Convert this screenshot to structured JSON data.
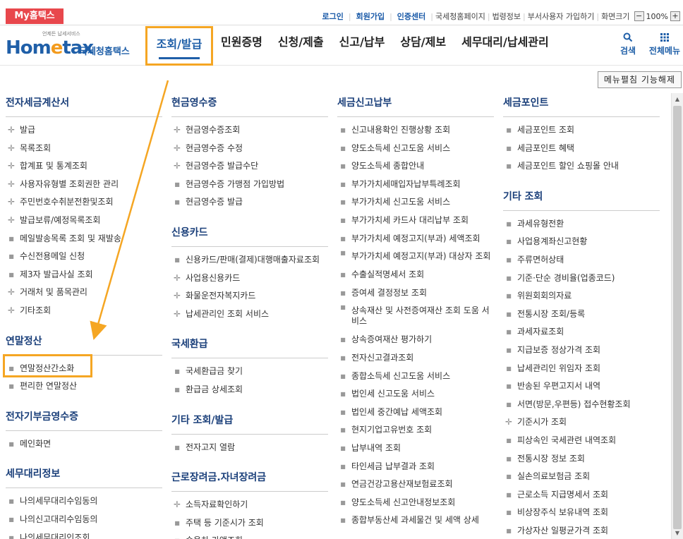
{
  "topbar": {
    "my_badge": "My홈택스",
    "links": [
      "로그인",
      "회원가입",
      "인증센터"
    ],
    "gray_links": [
      "국세청홈페이지",
      "법령정보",
      "부서사용자 가입하기",
      "화면크기"
    ],
    "zoom": {
      "minus": "−",
      "value": "100%",
      "plus": "+"
    }
  },
  "header": {
    "logo_small": "언제든 납세서비스",
    "logo_main_a": "Hom",
    "logo_main_e": "e",
    "logo_main_b": "tax",
    "logo_kr": "국세청홈택스",
    "nav": [
      "조회/발급",
      "민원증명",
      "신청/제출",
      "신고/납부",
      "상담/제보",
      "세무대리/납세관리"
    ],
    "search_label": "검색",
    "allmenu_label": "전체메뉴",
    "search_icon": "search-icon",
    "grid_icon": "grid-icon"
  },
  "collapse_button": "메뉴펼침 기능해제",
  "columns": [
    {
      "sections": [
        {
          "title": "전자세금계산서",
          "items": [
            {
              "label": "발급",
              "mark": "plus"
            },
            {
              "label": "목록조회",
              "mark": "plus"
            },
            {
              "label": "합계표 및 통계조회",
              "mark": "plus"
            },
            {
              "label": "사용자유형별 조회권한 관리",
              "mark": "plus"
            },
            {
              "label": "주민번호수취분전환및조회",
              "mark": "plus"
            },
            {
              "label": "발급보류/예정목록조회",
              "mark": "plus"
            },
            {
              "label": "메일발송목록 조회 및 재발송",
              "mark": "dot"
            },
            {
              "label": "수신전용메일 신청",
              "mark": "dot"
            },
            {
              "label": "제3자 발급사실 조회",
              "mark": "dot"
            },
            {
              "label": "거래처 및 품목관리",
              "mark": "plus"
            },
            {
              "label": "기타조회",
              "mark": "plus"
            }
          ]
        },
        {
          "title": "연말정산",
          "items": [
            {
              "label": "연말정산간소화",
              "mark": "dot"
            },
            {
              "label": "편리한 연말정산",
              "mark": "dot"
            }
          ]
        },
        {
          "title": "전자기부금영수증",
          "items": [
            {
              "label": "메인화면",
              "mark": "dot"
            }
          ]
        },
        {
          "title": "세무대리정보",
          "items": [
            {
              "label": "나의세무대리수임동의",
              "mark": "dot"
            },
            {
              "label": "나의신고대리수임동의",
              "mark": "dot"
            },
            {
              "label": "나의세무대리인조회",
              "mark": "dot"
            }
          ]
        }
      ]
    },
    {
      "sections": [
        {
          "title": "현금영수증",
          "items": [
            {
              "label": "현금영수증조회",
              "mark": "plus"
            },
            {
              "label": "현금영수증 수정",
              "mark": "plus"
            },
            {
              "label": "현금영수증 발급수단",
              "mark": "plus"
            },
            {
              "label": "현금영수증 가맹점 가입방법",
              "mark": "dot"
            },
            {
              "label": "현금영수증 발급",
              "mark": "dot"
            }
          ]
        },
        {
          "title": "신용카드",
          "items": [
            {
              "label": "신용카드/판매(결제)대행매출자료조회",
              "mark": "dot"
            },
            {
              "label": "사업용신용카드",
              "mark": "plus"
            },
            {
              "label": "화물운전자복지카드",
              "mark": "plus"
            },
            {
              "label": "납세관리인 조회 서비스",
              "mark": "plus"
            }
          ]
        },
        {
          "title": "국세환급",
          "items": [
            {
              "label": "국세환급금 찾기",
              "mark": "dot"
            },
            {
              "label": "환급금 상세조회",
              "mark": "dot"
            }
          ]
        },
        {
          "title": "기타 조회/발급",
          "items": [
            {
              "label": "전자고지 열람",
              "mark": "dot"
            }
          ]
        },
        {
          "title": "근로장려금.자녀장려금",
          "items": [
            {
              "label": "소득자료확인하기",
              "mark": "plus"
            },
            {
              "label": "주택 등 기준시가 조회",
              "mark": "dot"
            },
            {
              "label": "승용차 가액조회",
              "mark": "dot"
            }
          ]
        }
      ]
    },
    {
      "sections": [
        {
          "title": "세금신고납부",
          "items": [
            {
              "label": "신고내용확인 진행상황 조회",
              "mark": "dot"
            },
            {
              "label": "양도소득세 신고도움 서비스",
              "mark": "dot"
            },
            {
              "label": "양도소득세 종합안내",
              "mark": "dot"
            },
            {
              "label": "부가가치세매입자납부특례조회",
              "mark": "dot"
            },
            {
              "label": "부가가치세 신고도움 서비스",
              "mark": "dot"
            },
            {
              "label": "부가가치세 카드사 대리납부 조회",
              "mark": "dot"
            },
            {
              "label": "부가가치세 예정고지(부과) 세액조회",
              "mark": "dot"
            },
            {
              "label": "부가가치세 예정고지(부과) 대상자 조회",
              "mark": "dot",
              "wrap": true
            },
            {
              "label": "수출실적명세서 조회",
              "mark": "dot"
            },
            {
              "label": "증여세 결정정보 조회",
              "mark": "dot"
            },
            {
              "label": "상속재산 및 사전증여재산 조회 도움 서비스",
              "mark": "dot",
              "wrap": true
            },
            {
              "label": "상속증여재산 평가하기",
              "mark": "dot"
            },
            {
              "label": "전자신고결과조회",
              "mark": "dot"
            },
            {
              "label": "종합소득세 신고도움 서비스",
              "mark": "dot"
            },
            {
              "label": "법인세 신고도움 서비스",
              "mark": "dot"
            },
            {
              "label": "법인세 중간예납 세액조회",
              "mark": "dot"
            },
            {
              "label": "현지기업고유번호 조회",
              "mark": "dot"
            },
            {
              "label": "납부내역 조회",
              "mark": "dot"
            },
            {
              "label": "타인세금 납부결과 조회",
              "mark": "dot"
            },
            {
              "label": "연금건강고용산재보험료조회",
              "mark": "dot"
            },
            {
              "label": "양도소득세 신고안내정보조회",
              "mark": "dot"
            },
            {
              "label": "종합부동산세 과세물건 및 세액 상세",
              "mark": "dot"
            }
          ]
        }
      ]
    },
    {
      "sections": [
        {
          "title": "세금포인트",
          "items": [
            {
              "label": "세금포인트 조회",
              "mark": "dot"
            },
            {
              "label": "세금포인트 혜택",
              "mark": "dot"
            },
            {
              "label": "세금포인트 할인 쇼핑몰 안내",
              "mark": "dot"
            }
          ]
        },
        {
          "title": "기타 조회",
          "items": [
            {
              "label": "과세유형전환",
              "mark": "dot"
            },
            {
              "label": "사업용계좌신고현황",
              "mark": "dot"
            },
            {
              "label": "주류면허상태",
              "mark": "dot"
            },
            {
              "label": "기준·단순 경비율(업종코드)",
              "mark": "dot"
            },
            {
              "label": "위원회회의자료",
              "mark": "dot"
            },
            {
              "label": "전통시장 조회/등록",
              "mark": "dot"
            },
            {
              "label": "과세자료조회",
              "mark": "dot"
            },
            {
              "label": "지급보증 정상가격 조회",
              "mark": "dot"
            },
            {
              "label": "납세관리인 위임자 조회",
              "mark": "dot"
            },
            {
              "label": "반송된 우편고지서 내역",
              "mark": "dot"
            },
            {
              "label": "서면(방문,우편등) 접수현황조회",
              "mark": "dot"
            },
            {
              "label": "기준시가 조회",
              "mark": "plus"
            },
            {
              "label": "피상속인 국세관련 내역조회",
              "mark": "dot"
            },
            {
              "label": "전통시장 정보 조회",
              "mark": "dot"
            },
            {
              "label": "실손의료보험금 조회",
              "mark": "dot"
            },
            {
              "label": "근로소득 지급명세서 조회",
              "mark": "dot"
            },
            {
              "label": "비상장주식 보유내역 조회",
              "mark": "dot"
            },
            {
              "label": "가상자산 일평균가격 조회",
              "mark": "dot"
            }
          ]
        }
      ]
    }
  ]
}
